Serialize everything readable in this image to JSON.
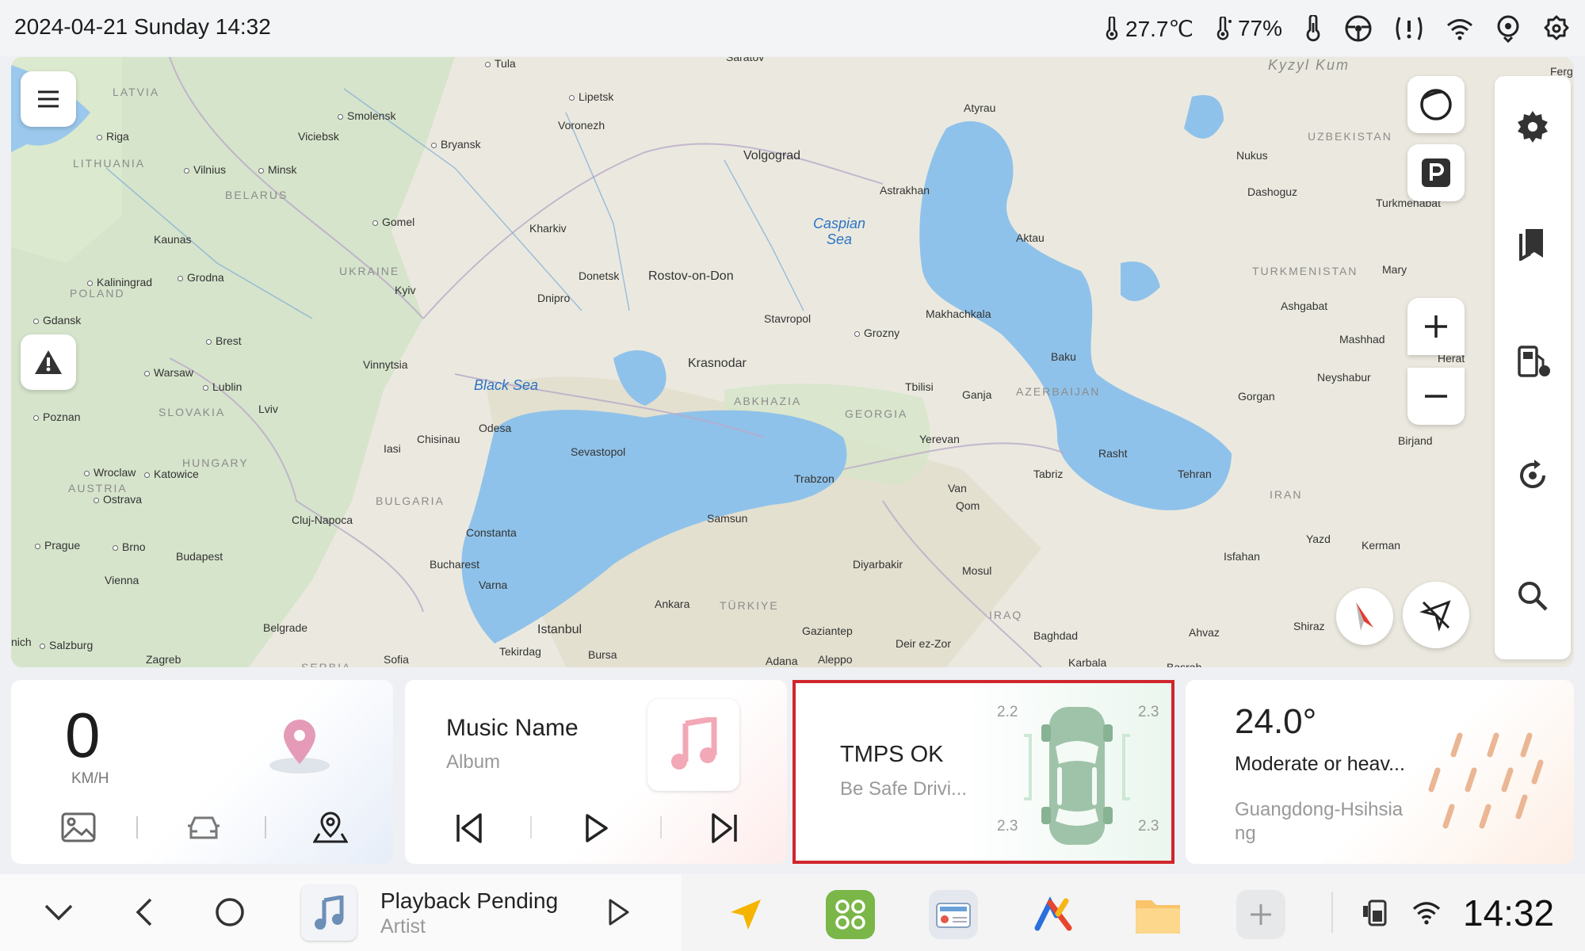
{
  "status": {
    "datetime": "2024-04-21 Sunday 14:32",
    "temperature": "27.7℃",
    "humidity": "77%"
  },
  "map": {
    "seas": [
      "Black Sea",
      "Caspian Sea"
    ],
    "countries": [
      "LATVIA",
      "LITHUANIA",
      "BELARUS",
      "UKRAINE",
      "POLAND",
      "SLOVAKIA",
      "HUNGARY",
      "AUSTRIA",
      "BULGARIA",
      "SERBIA",
      "ABKHAZIA",
      "GEORGIA",
      "AZERBAIJAN",
      "TURKMENISTAN",
      "UZBEKISTAN",
      "IRAN",
      "IRAQ",
      "TÜRKIYE",
      "Kyzyl Kum"
    ],
    "cities": [
      "Tula",
      "Lipetsk",
      "Saratov",
      "Riga",
      "Smolensk",
      "Viciebsk",
      "Bryansk",
      "Voronezh",
      "Volgograd",
      "Atyrau",
      "Vilnius",
      "Minsk",
      "Kaunas",
      "Gomel",
      "Kharkiv",
      "Astrakhan",
      "Aktau",
      "Nukus",
      "Dashoguz",
      "Turkmenabat",
      "Kaliningrad",
      "Grodna",
      "Kyiv",
      "Donetsk",
      "Rostov-on-Don",
      "Dnipro",
      "Mary",
      "Ashgabat",
      "Gdansk",
      "Brest",
      "Stavropol",
      "Makhachkala",
      "Grozny",
      "Mashhad",
      "Herat",
      "Warsaw",
      "Vinnytsia",
      "Krasnodar",
      "Baku",
      "Neyshabur",
      "Lublin",
      "Lviv",
      "Tbilisi",
      "Ganja",
      "Gorgan",
      "Poznan",
      "Chisinau",
      "Odesa",
      "Yerevan",
      "Birjand",
      "Iasi",
      "Sevastopol",
      "Rasht",
      "Wroclaw",
      "Katowice",
      "Trabzon",
      "Tabriz",
      "Tehran",
      "Ostrava",
      "Van",
      "Qom",
      "Cluj-Napoca",
      "Samsun",
      "Prague",
      "Brno",
      "Constanta",
      "Isfahan",
      "Yazd",
      "Kerman",
      "Budapest",
      "Bucharest",
      "Diyarbakir",
      "Mosul",
      "Vienna",
      "Varna",
      "Ankara",
      "Salzburg",
      "Belgrade",
      "Istanbul",
      "Gaziantep",
      "Baghdad",
      "Ahvaz",
      "Shiraz",
      "Zagreb",
      "Sofia",
      "Tekirdag",
      "Bursa",
      "Adana",
      "Aleppo",
      "Deir ez-Zor",
      "Karbala",
      "Basrah",
      "Ferg",
      "nich"
    ]
  },
  "speed_card": {
    "value": "0",
    "unit": "KM/H"
  },
  "music_card": {
    "title": "Music Name",
    "album": "Album"
  },
  "tpms_card": {
    "status": "TMPS OK",
    "message": "Be Safe Drivi...",
    "front_left": "2.2",
    "front_right": "2.3",
    "rear_left": "2.3",
    "rear_right": "2.3"
  },
  "weather_card": {
    "temp": "24.0°",
    "condition": "Moderate or heav...",
    "location_line1": "Guangdong-Hsihsia",
    "location_line2": "ng"
  },
  "dock": {
    "track": "Playback Pending",
    "artist": "Artist",
    "time": "14:32"
  },
  "colors": {
    "highlight": "#d0262b",
    "water": "#8fc2ea",
    "land": "#e9e7dc"
  }
}
